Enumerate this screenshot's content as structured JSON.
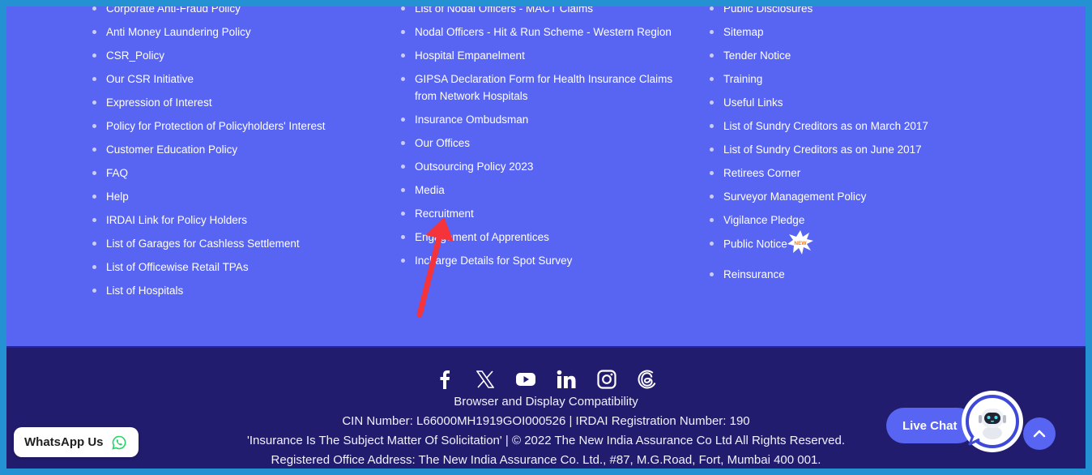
{
  "links": {
    "column_1": [
      "Corporate Anti-Fraud Policy",
      "Anti Money Laundering Policy",
      "CSR_Policy",
      "Our CSR Initiative",
      "Expression of Interest",
      "Policy for Protection of Policyholders' Interest",
      "Customer Education Policy",
      "FAQ",
      "Help",
      "IRDAI Link for Policy Holders",
      "List of Garages for Cashless Settlement",
      "List of Officewise Retail TPAs",
      "List of Hospitals"
    ],
    "column_2": [
      "List of Nodal Officers - MACT Claims",
      "Nodal Officers - Hit & Run Scheme - Western Region",
      "Hospital Empanelment",
      "GIPSA Declaration Form for Health Insurance Claims from Network Hospitals",
      "Insurance Ombudsman",
      "Our Offices",
      "Outsourcing Policy 2023",
      "Media",
      "Recruitment",
      "Engagement of Apprentices",
      "Incharge Details for Spot Survey"
    ],
    "column_3": [
      "Public Disclosures",
      "Sitemap",
      "Tender Notice",
      "Training",
      "Useful Links",
      "List of Sundry Creditors as on March 2017",
      "List of Sundry Creditors as on June 2017",
      "Retirees Corner",
      "Surveyor Management Policy",
      "Vigilance Pledge",
      "Public Notice",
      "Reinsurance"
    ],
    "new_badge_label": "NEW"
  },
  "footer": {
    "social_icons": [
      "facebook-icon",
      "x-twitter-icon",
      "youtube-icon",
      "linkedin-icon",
      "instagram-icon",
      "threads-icon"
    ],
    "browser_compat": "Browser and Display Compatibility",
    "cin_line": "CIN Number: L66000MH1919GOI000526 | IRDAI Registration Number: 190",
    "copyright_line": "'Insurance Is The Subject Matter Of Solicitation' | © 2022 The New India Assurance Co Ltd All Rights Reserved.",
    "address_line": "Registered Office Address: The New India Assurance Co. Ltd., #87, M.G.Road, Fort, Mumbai 400 001."
  },
  "widgets": {
    "whatsapp_label": "WhatsApp Us",
    "live_chat_label": "Live Chat"
  },
  "colors": {
    "frame": "#2391d2",
    "links_bg": "#5865f2",
    "footer_bg": "#221c6e",
    "annotation_arrow": "#f5333a",
    "whatsapp_green": "#25d366"
  }
}
